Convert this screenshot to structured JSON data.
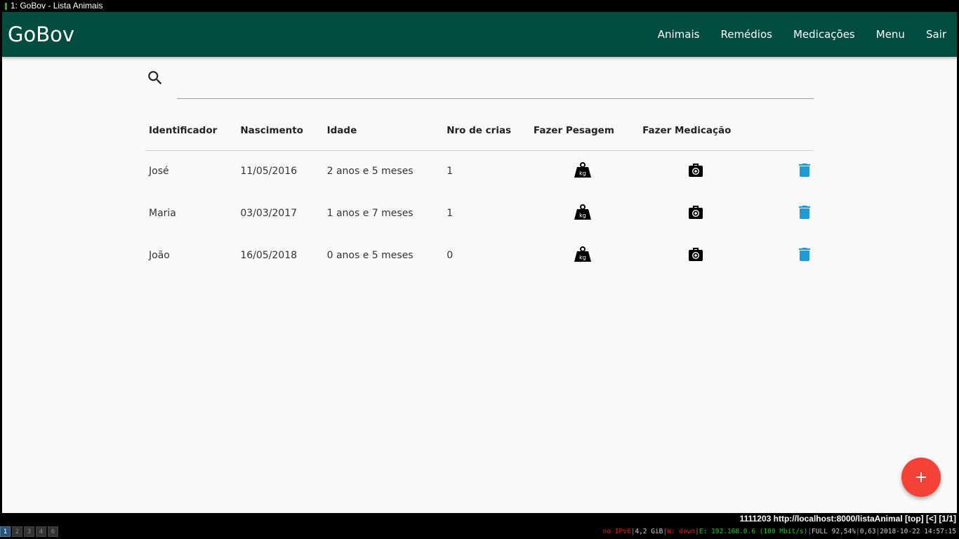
{
  "window": {
    "title": "1: GoBov - Lista Animais"
  },
  "navbar": {
    "brand": "GoBov",
    "links": [
      "Animais",
      "Remédios",
      "Medicações",
      "Menu",
      "Sair"
    ]
  },
  "search": {
    "placeholder": "",
    "value": ""
  },
  "table": {
    "headers": [
      "Identificador",
      "Nascimento",
      "Idade",
      "Nro de crias",
      "Fazer Pesagem",
      "Fazer Medicação"
    ],
    "rows": [
      {
        "id": "José",
        "birth": "11/05/2016",
        "age": "2 anos e 5 meses",
        "offspring": "1"
      },
      {
        "id": "Maria",
        "birth": "03/03/2017",
        "age": "1 anos e 7 meses",
        "offspring": "1"
      },
      {
        "id": "João",
        "birth": "16/05/2018",
        "age": "0 anos e 5 meses",
        "offspring": "0"
      }
    ],
    "weight_icon_text": "kg"
  },
  "fab": {
    "label": "+"
  },
  "browser_status": {
    "text": "1111203  http://localhost:8000/listaAnimal  [top]  [<]  [1/1]"
  },
  "bottom_bar": {
    "workspaces": [
      "1",
      "2",
      "3",
      "4",
      "6"
    ],
    "status": {
      "ipv6": "no IPv6",
      "disk": "4,2 GiB",
      "wifi": "W: down",
      "ethernet": "E: 192.168.0.6 (100 Mbit/s)",
      "battery": "FULL 92,54%",
      "load": "0,63",
      "datetime": "2018-10-22 14:57:15"
    }
  },
  "colors": {
    "navbar": "#004d40",
    "link": "#1e9bd6",
    "fab": "#f44336",
    "delete_icon": "#1e9bd6"
  }
}
